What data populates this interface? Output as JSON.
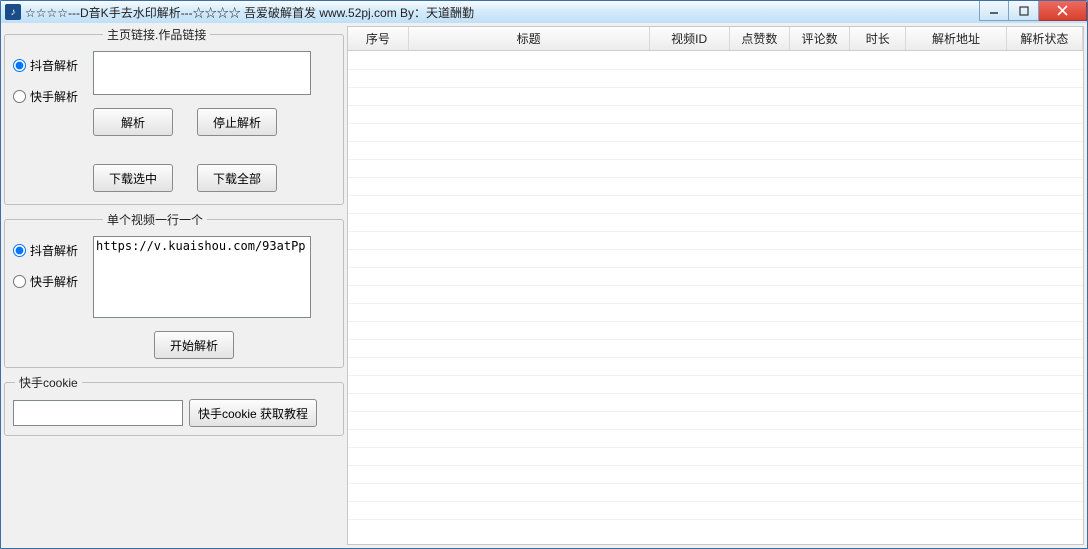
{
  "window": {
    "title": "☆☆☆☆---D音K手去水印解析---☆☆☆☆ 吾爱破解首发  www.52pj.com   By：天道酬勤"
  },
  "group1": {
    "legend": "主页链接.作品链接",
    "radio_douyin": "抖音解析",
    "radio_kuaishou": "快手解析",
    "link_value": "",
    "btn_parse": "解析",
    "btn_stop": "停止解析",
    "btn_dl_sel": "下载选中",
    "btn_dl_all": "下载全部"
  },
  "group2": {
    "legend": "单个视频一行一个",
    "radio_douyin": "抖音解析",
    "radio_kuaishou": "快手解析",
    "multi_value": "https://v.kuaishou.com/93atPp",
    "btn_start": "开始解析"
  },
  "group3": {
    "legend": "快手cookie",
    "cookie_value": "",
    "btn_tutorial": "快手cookie 获取教程"
  },
  "table": {
    "columns": [
      "序号",
      "标题",
      "视频ID",
      "点赞数",
      "评论数",
      "时长",
      "解析地址",
      "解析状态"
    ],
    "widths": [
      60,
      240,
      80,
      60,
      60,
      56,
      100,
      76
    ],
    "rows": []
  }
}
